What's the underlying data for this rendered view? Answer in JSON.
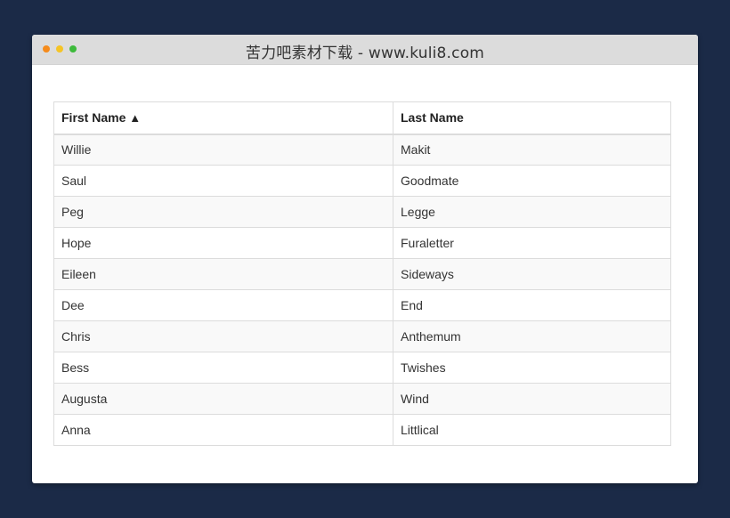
{
  "window": {
    "title": "苦力吧素材下载 - www.kuli8.com",
    "dots": [
      "close",
      "minimize",
      "maximize"
    ]
  },
  "table": {
    "columns": [
      {
        "label": "First Name",
        "sort_indicator": "▲"
      },
      {
        "label": "Last Name",
        "sort_indicator": ""
      }
    ],
    "rows": [
      {
        "first": "Willie",
        "last": "Makit"
      },
      {
        "first": "Saul",
        "last": "Goodmate"
      },
      {
        "first": "Peg",
        "last": "Legge"
      },
      {
        "first": "Hope",
        "last": "Furaletter"
      },
      {
        "first": "Eileen",
        "last": "Sideways"
      },
      {
        "first": "Dee",
        "last": "End"
      },
      {
        "first": "Chris",
        "last": "Anthemum"
      },
      {
        "first": "Bess",
        "last": "Twishes"
      },
      {
        "first": "Augusta",
        "last": "Wind"
      },
      {
        "first": "Anna",
        "last": "Littlical"
      }
    ]
  },
  "colors": {
    "page_background": "#1b2a47",
    "titlebar": "#dcdcdc",
    "dot_close": "#f58b1c",
    "dot_minimize": "#f5c426",
    "dot_maximize": "#3dba3b",
    "stripe": "#f9f9f9",
    "border": "#dcdcdc"
  }
}
